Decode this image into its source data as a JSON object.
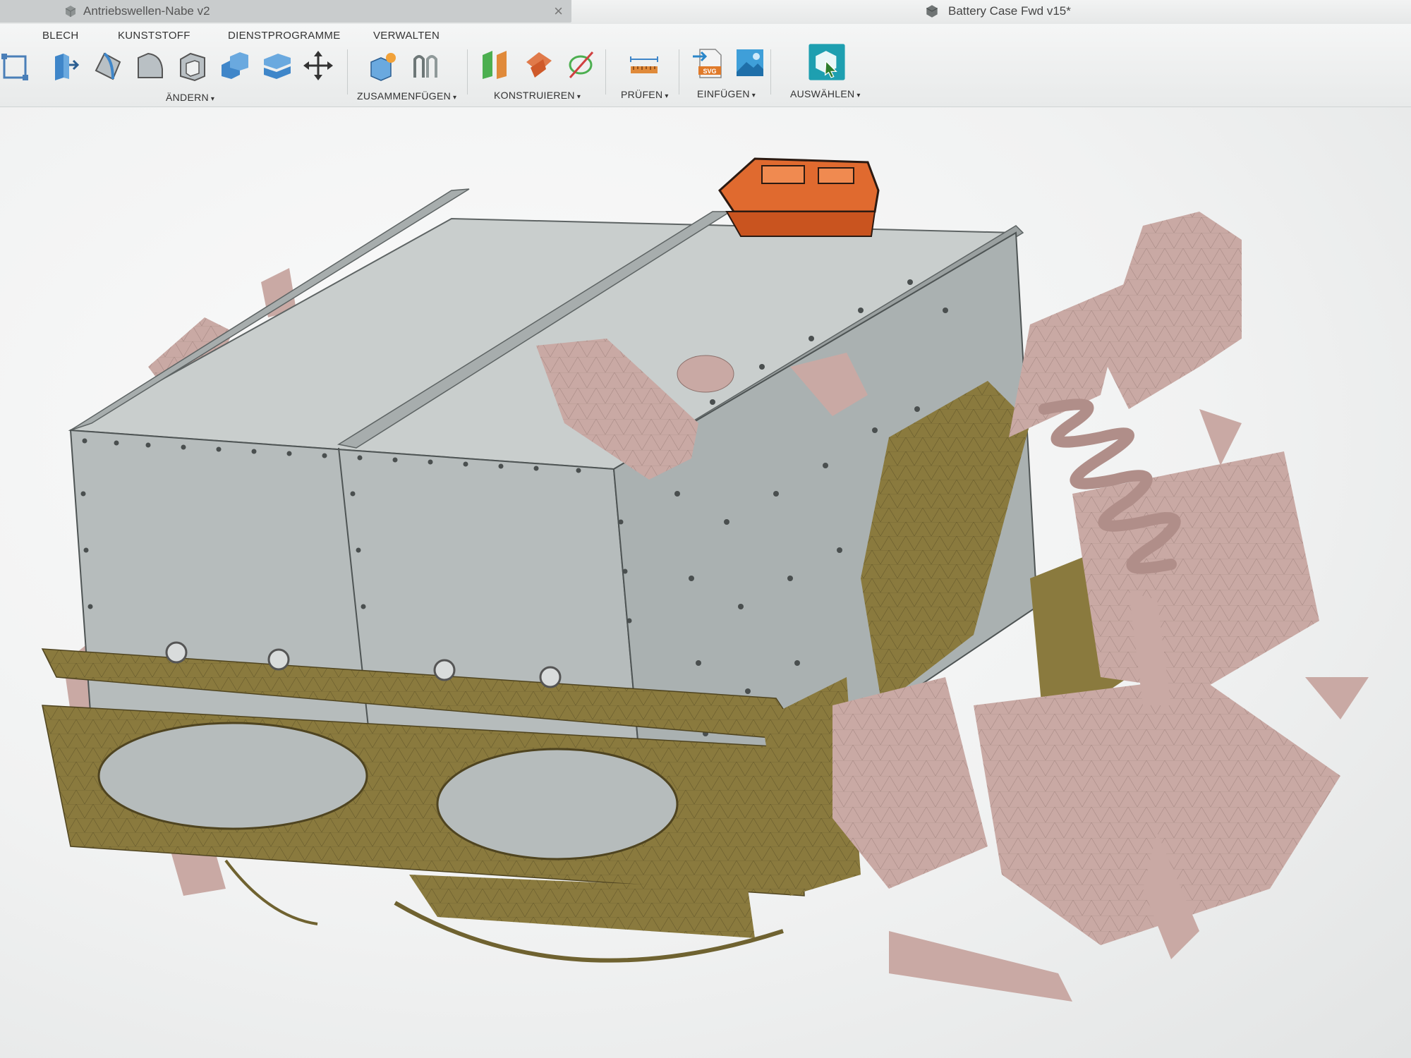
{
  "tabs": {
    "active_document": "Antriebswellen-Nabe v2",
    "close_symbol": "×",
    "second_document": "Battery Case Fwd v15*"
  },
  "ribbon": {
    "tabs": [
      "BLECH",
      "KUNSTSTOFF",
      "DIENSTPROGRAMME",
      "VERWALTEN"
    ],
    "groups": {
      "aendern": "ÄNDERN",
      "zusammenfuegen": "ZUSAMMENFÜGEN",
      "konstruieren": "KONSTRUIEREN",
      "pruefen": "PRÜFEN",
      "einfuegen": "EINFÜGEN",
      "auswaehlen": "AUSWÄHLEN"
    },
    "caret": "▾",
    "svg_badge": "SVG",
    "icons": [
      "sketch-icon",
      "press-pull-icon",
      "fillet-icon",
      "chamfer-icon",
      "shell-icon",
      "combine-icon",
      "offset-face-icon",
      "move-icon",
      "new-component-icon",
      "joint-icon",
      "offset-plane-icon",
      "plane-at-angle-icon",
      "axis-icon",
      "measure-icon",
      "insert-svg-icon",
      "decal-icon",
      "select-icon"
    ]
  },
  "colors": {
    "box_face": "#b6bcbc",
    "box_top": "#c9cecd",
    "frame_olive": "#8a7a3e",
    "scan_pink": "#c9a9a4",
    "component_orange": "#e06a2f",
    "select_teal": "#1e9fb0"
  }
}
